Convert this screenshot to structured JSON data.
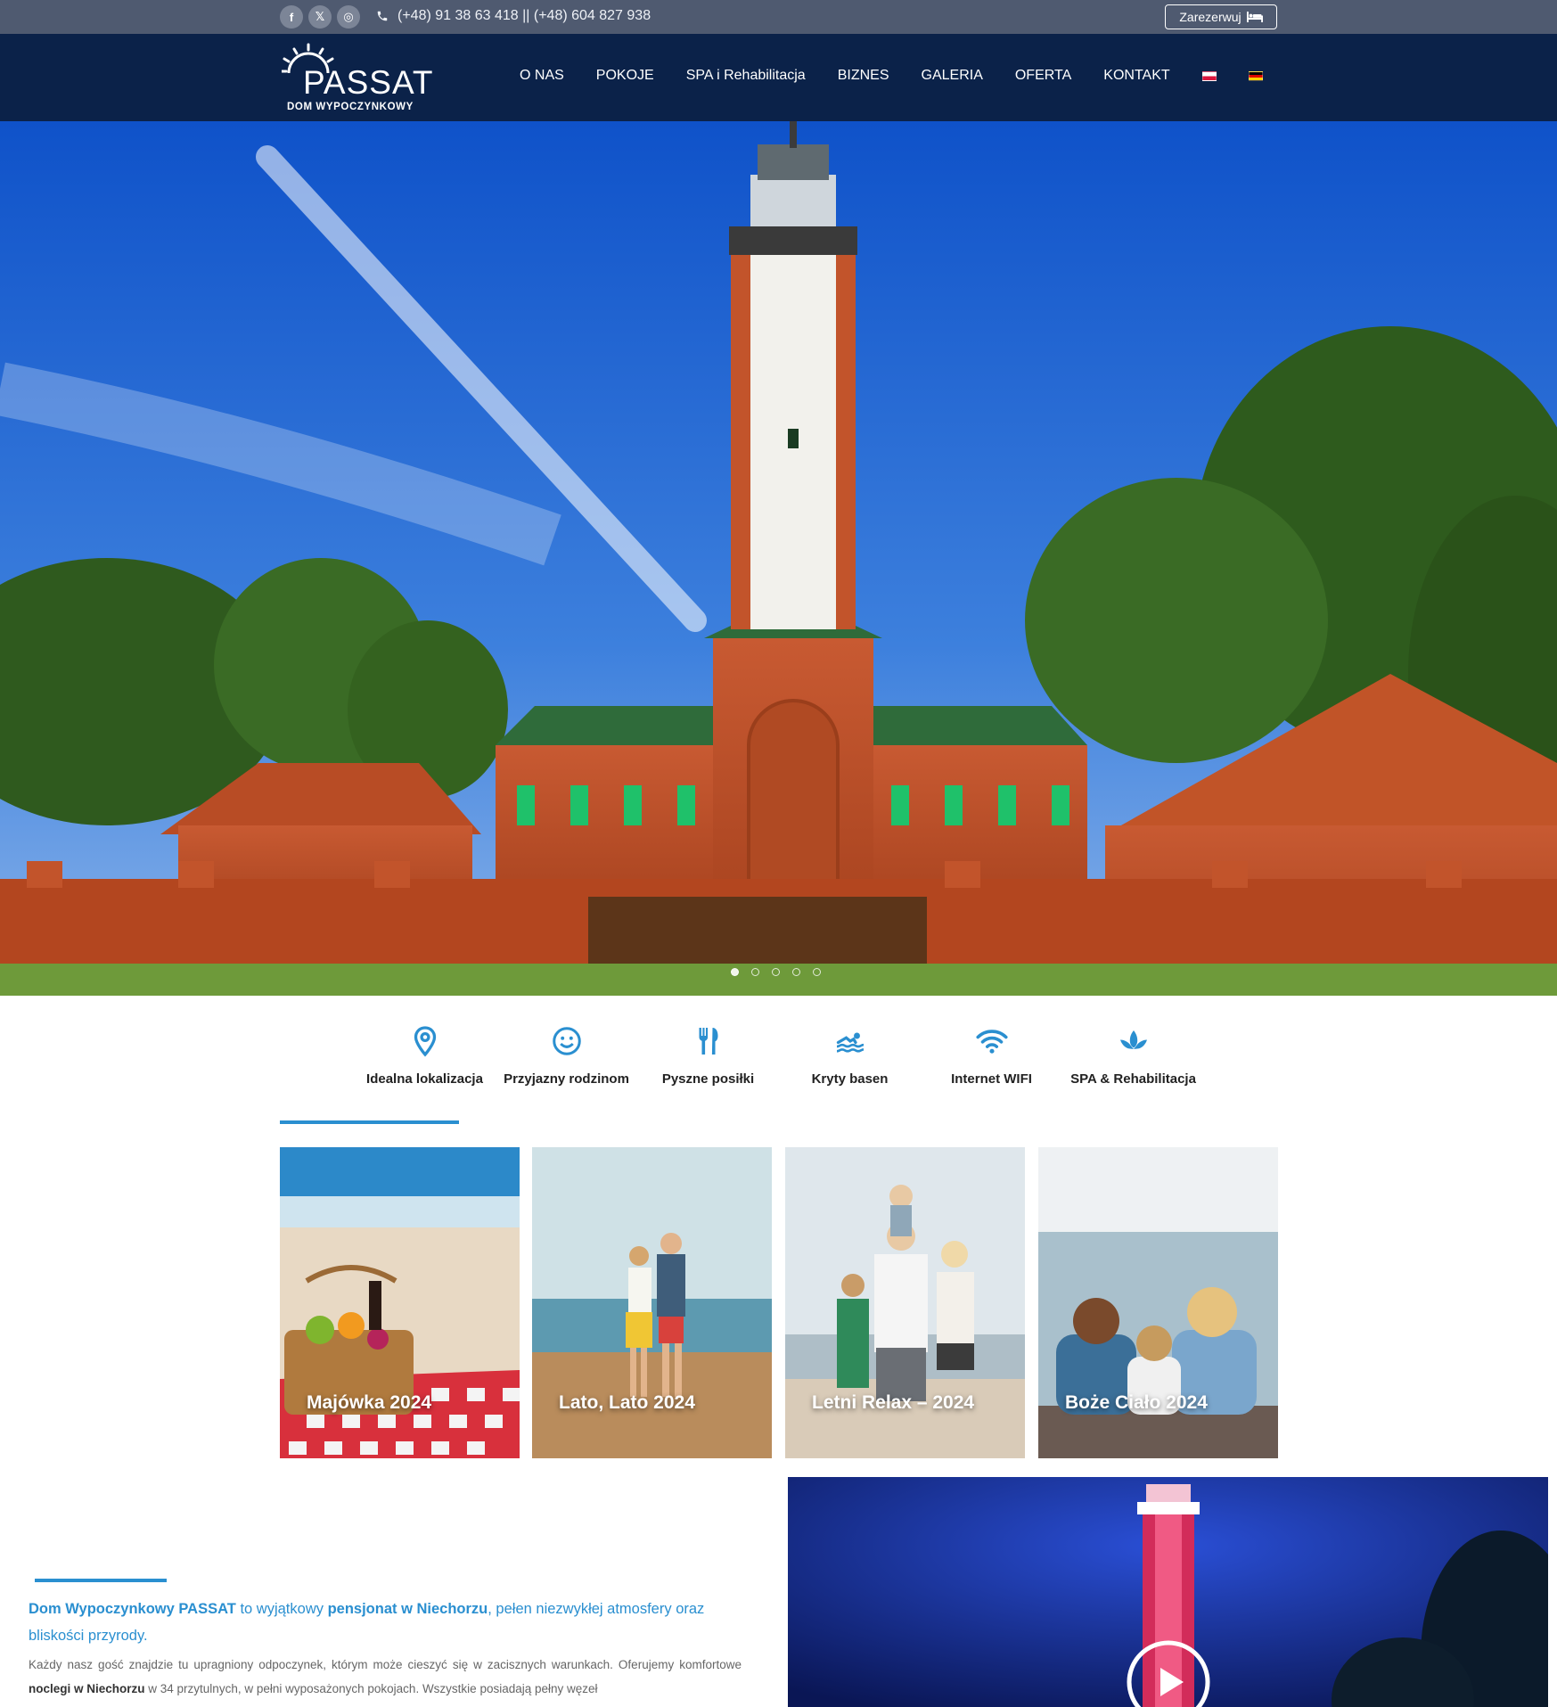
{
  "topbar": {
    "socials": [
      {
        "icon": "facebook-icon",
        "glyph": "f"
      },
      {
        "icon": "x-icon",
        "glyph": "𝕏"
      },
      {
        "icon": "instagram-icon",
        "glyph": "◎"
      }
    ],
    "phone": "(+48) 91 38 63 418 || (+48) 604 827 938",
    "book_label": "Zarezerwuj"
  },
  "logo": {
    "name": "PASSAT",
    "subtitle": "DOM WYPOCZYNKOWY"
  },
  "nav": {
    "items": [
      "O NAS",
      "POKOJE",
      "SPA i Rehabilitacja",
      "BIZNES",
      "GALERIA",
      "OFERTA",
      "KONTAKT"
    ],
    "flags": [
      "pl",
      "de"
    ]
  },
  "features": [
    {
      "icon": "location-pin-icon",
      "label": "Idealna lokalizacja"
    },
    {
      "icon": "smiley-icon",
      "label": "Przyjazny rodzinom"
    },
    {
      "icon": "cutlery-icon",
      "label": "Pyszne posiłki"
    },
    {
      "icon": "swimmer-icon",
      "label": "Kryty basen"
    },
    {
      "icon": "wifi-icon",
      "label": "Internet WIFI"
    },
    {
      "icon": "lotus-icon",
      "label": "SPA & Rehabilitacja"
    }
  ],
  "offers": [
    {
      "title": "Majówka 2024"
    },
    {
      "title": "Lato, Lato 2024"
    },
    {
      "title": "Letni Relax – 2024"
    },
    {
      "title": "Boże Ciało 2024"
    }
  ],
  "about": {
    "lead_a": "Dom Wypoczynkowy PASSAT",
    "lead_b": " to wyjątkowy ",
    "lead_c": "pensjonat w Niechorzu",
    "lead_d": ", pełen niezwykłej atmosfery oraz bliskości przyrody.",
    "text_a": "Każdy nasz gość znajdzie tu upragniony odpoczynek, którym może cieszyć się w zacisznych warunkach. Oferujemy komfortowe ",
    "text_b": "noclegi w Niechorzu",
    "text_c": " w 34 przytulnych, w pełni wyposażonych pokojach. Wszystkie posiadają pełny węzeł"
  },
  "colors": {
    "accent": "#2a8fd0",
    "header": "#0b2249",
    "topbar": "#4f5a70"
  }
}
